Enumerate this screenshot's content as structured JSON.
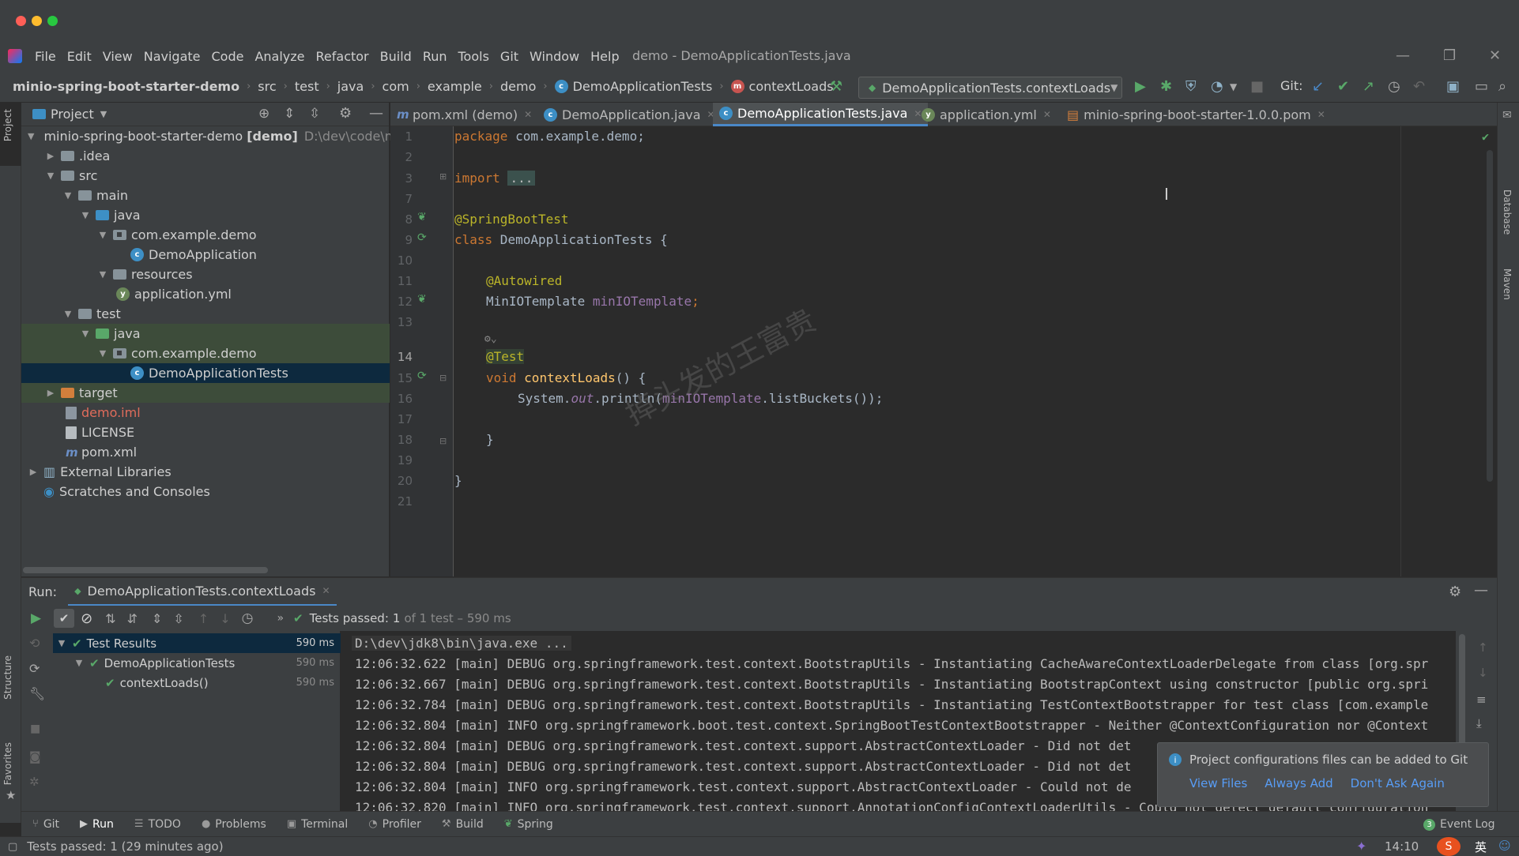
{
  "menu": {
    "items": [
      "File",
      "Edit",
      "View",
      "Navigate",
      "Code",
      "Analyze",
      "Refactor",
      "Build",
      "Run",
      "Tools",
      "Git",
      "Window",
      "Help"
    ],
    "window_title": "demo - DemoApplicationTests.java"
  },
  "nav": {
    "breadcrumbs": [
      "minio-spring-boot-starter-demo",
      "src",
      "test",
      "java",
      "com",
      "example",
      "demo",
      "DemoApplicationTests",
      "contextLoads"
    ],
    "run_config": "DemoApplicationTests.contextLoads",
    "git_label": "Git:"
  },
  "project": {
    "header": "Project",
    "root_name": "minio-spring-boot-starter-demo",
    "root_module": "[demo]",
    "root_path": "D:\\dev\\code\\m",
    "nodes": [
      ".idea",
      "src",
      "main",
      "java",
      "com.example.demo",
      "DemoApplication",
      "resources",
      "application.yml",
      "test",
      "java",
      "com.example.demo",
      "DemoApplicationTests",
      "target",
      "demo.iml",
      "LICENSE",
      "pom.xml",
      "External Libraries",
      "Scratches and Consoles"
    ]
  },
  "editor": {
    "tabs": [
      "pom.xml (demo)",
      "DemoApplication.java",
      "DemoApplicationTests.java",
      "application.yml",
      "minio-spring-boot-starter-1.0.0.pom"
    ],
    "line_numbers": [
      "1",
      "2",
      "3",
      "7",
      "8",
      "9",
      "10",
      "11",
      "12",
      "13",
      "14",
      "15",
      "16",
      "17",
      "18",
      "19",
      "20",
      "21"
    ],
    "code": {
      "package_kw": "package",
      "package_name": " com.example.demo;",
      "import_kw": "import",
      "import_fold": "...",
      "annotation_sbt": "@SpringBootTest",
      "class_kw": "class",
      "class_name": " DemoApplicationTests {",
      "autowired": "@Autowired",
      "field_type": "MinIOTemplate",
      "field_name": "minIOTemplate",
      "semicolon": ";",
      "test_ann": "@Test",
      "void_kw": "void",
      "method_name": "contextLoads",
      "method_sig": "() {",
      "sys": "System.",
      "out": "out",
      "println": ".println(",
      "arg_field": "minIOTemplate",
      "call_end": ".listBuckets());",
      "close_method": "}",
      "close_class": "}"
    },
    "watermark": "掉头发的王富贵"
  },
  "run": {
    "label": "Run:",
    "tab": "DemoApplicationTests.contextLoads",
    "summary_prefix": "Tests passed:",
    "summary_count": "1",
    "summary_suffix": "of 1 test – 590 ms",
    "tests": [
      {
        "name": "Test Results",
        "time": "590 ms"
      },
      {
        "name": "DemoApplicationTests",
        "time": "590 ms"
      },
      {
        "name": "contextLoads()",
        "time": "590 ms"
      }
    ],
    "console": [
      "D:\\dev\\jdk8\\bin\\java.exe ...",
      "12:06:32.622 [main] DEBUG org.springframework.test.context.BootstrapUtils - Instantiating CacheAwareContextLoaderDelegate from class [org.spr",
      "12:06:32.667 [main] DEBUG org.springframework.test.context.BootstrapUtils - Instantiating BootstrapContext using constructor [public org.spri",
      "12:06:32.784 [main] DEBUG org.springframework.test.context.BootstrapUtils - Instantiating TestContextBootstrapper for test class [com.example",
      "12:06:32.804 [main] INFO org.springframework.boot.test.context.SpringBootTestContextBootstrapper - Neither @ContextConfiguration nor @Context",
      "12:06:32.804 [main] DEBUG org.springframework.test.context.support.AbstractContextLoader - Did not det",
      "12:06:32.804 [main] DEBUG org.springframework.test.context.support.AbstractContextLoader - Did not det",
      "12:06:32.804 [main] INFO org.springframework.test.context.support.AbstractContextLoader - Could not de",
      "12:06:32.820 [main] INFO org.springframework.test.context.support.AnnotationConfigContextLoaderUtils - Could not detect default configuration"
    ]
  },
  "notification": {
    "message": "Project configurations files can be added to Git",
    "actions": [
      "View Files",
      "Always Add",
      "Don't Ask Again"
    ]
  },
  "tool_tabs": [
    "Git",
    "Run",
    "TODO",
    "Problems",
    "Terminal",
    "Profiler",
    "Build",
    "Spring"
  ],
  "side_tabs": {
    "project": "Project",
    "structure": "Structure",
    "favorites": "Favorites",
    "database": "Database",
    "maven": "Maven"
  },
  "status": {
    "message": "Tests passed: 1 (29 minutes ago)",
    "event_log": "Event Log",
    "event_count": "3",
    "time": "14:10",
    "ime": "英"
  },
  "colors": {
    "accent": "#4a88c7",
    "pass": "#59a869",
    "link": "#589df6"
  }
}
